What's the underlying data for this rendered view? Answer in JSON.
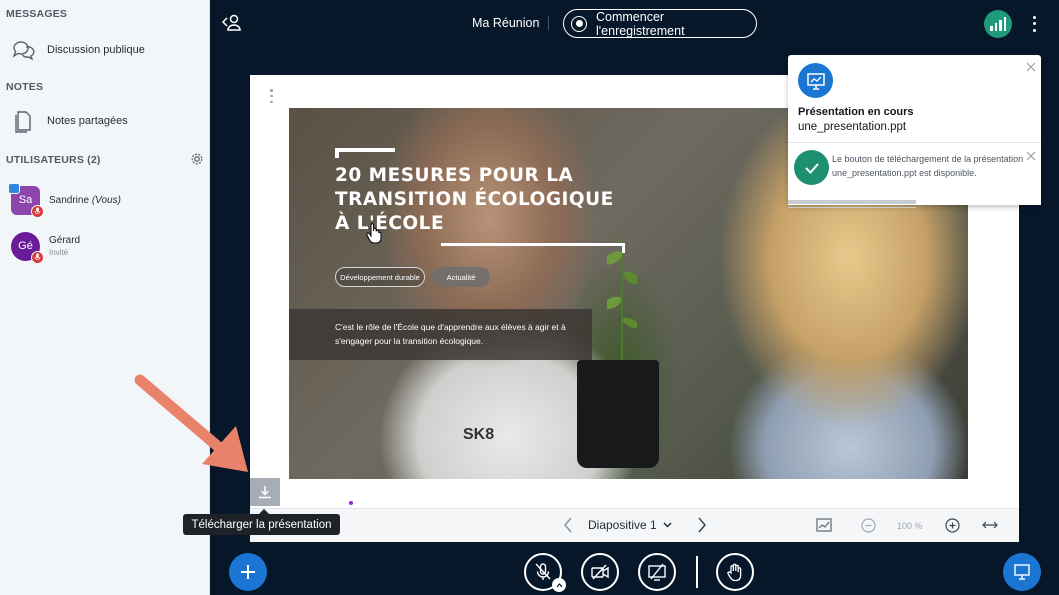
{
  "sidebar": {
    "messages_title": "MESSAGES",
    "public_chat_label": "Discussion publique",
    "notes_title": "NOTES",
    "shared_notes_label": "Notes partagées",
    "users_title": "UTILISATEURS (2)",
    "users": [
      {
        "initials": "Sa",
        "name": "Sandrine",
        "suffix": "(Vous)",
        "role": "",
        "color": "#8e44ad"
      },
      {
        "initials": "Gé",
        "name": "Gérard",
        "suffix": "",
        "role": "Invité",
        "color": "#7b1fa2"
      }
    ]
  },
  "topbar": {
    "meeting_title": "Ma Réunion",
    "record_label": "Commencer l'enregistrement"
  },
  "slide": {
    "title": "20 MESURES POUR LA TRANSITION ÉCOLOGIQUE À L'ÉCOLE",
    "tags": [
      "Développement durable",
      "Actualité"
    ],
    "caption": "C'est le rôle de l'École que d'apprendre aux élèves à agir et à s'engager pour la transition écologique.",
    "shirt_text": "SK8"
  },
  "toast": {
    "title": "Présentation en cours",
    "filename": "une_presentation.ppt",
    "download_message": "Le bouton de téléchargement de la présentation une_presentation.ppt est disponible."
  },
  "pres_toolbar": {
    "tooltip": "Télécharger la présentation",
    "slide_label": "Diapositive 1",
    "zoom": "100 %"
  },
  "colors": {
    "accent_blue": "#1a76d2",
    "success_green": "#1f8f72",
    "dark_bg": "#06172a"
  }
}
